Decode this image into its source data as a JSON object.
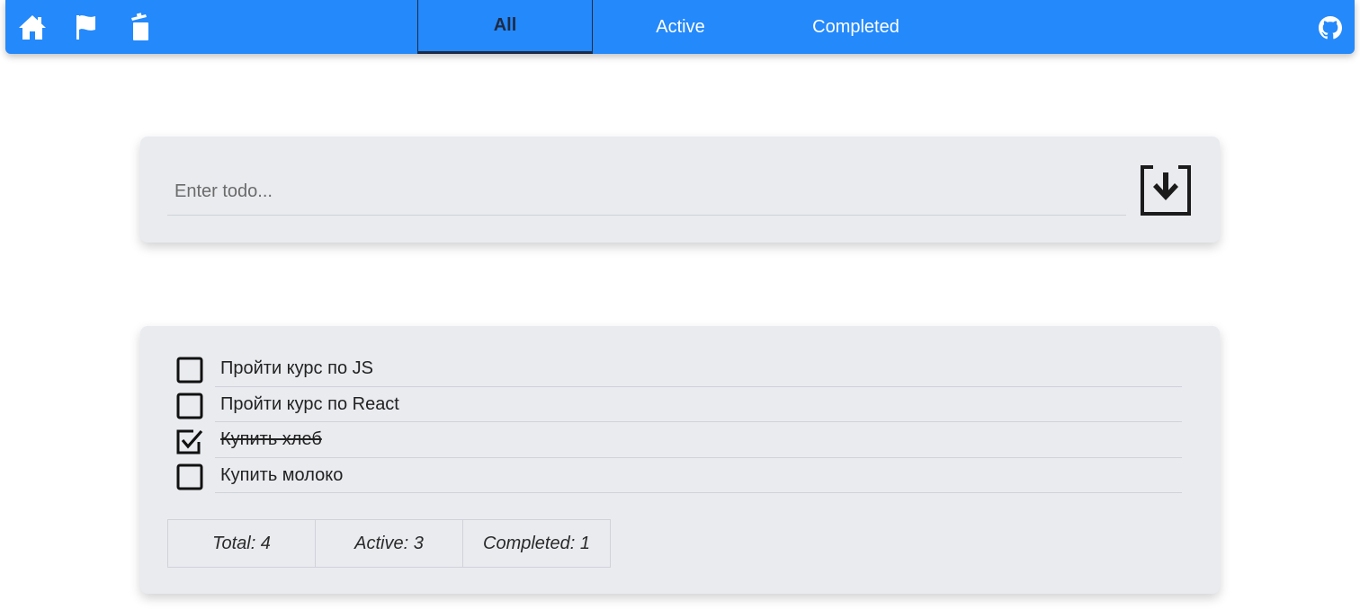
{
  "nav": {
    "icons": [
      "home-icon",
      "flag-icon",
      "trash-icon"
    ],
    "tabs": [
      {
        "label": "All"
      },
      {
        "label": "Active"
      },
      {
        "label": "Completed"
      }
    ],
    "selected_tab": "All",
    "github_icon": "github-icon",
    "colors": {
      "bar": "#2489fb",
      "active_tab_text": "#1e2a44"
    }
  },
  "input": {
    "placeholder": "Enter todo...",
    "value": "",
    "submit_icon": "download-icon"
  },
  "todos": [
    {
      "text": "Пройти курс по JS",
      "completed": false
    },
    {
      "text": "Пройти курс по React",
      "completed": false
    },
    {
      "text": "Купить хлеб",
      "completed": true
    },
    {
      "text": "Купить молоко",
      "completed": false
    }
  ],
  "stats": {
    "total": "Total: 4",
    "active": "Active: 3",
    "completed": "Completed: 1"
  }
}
